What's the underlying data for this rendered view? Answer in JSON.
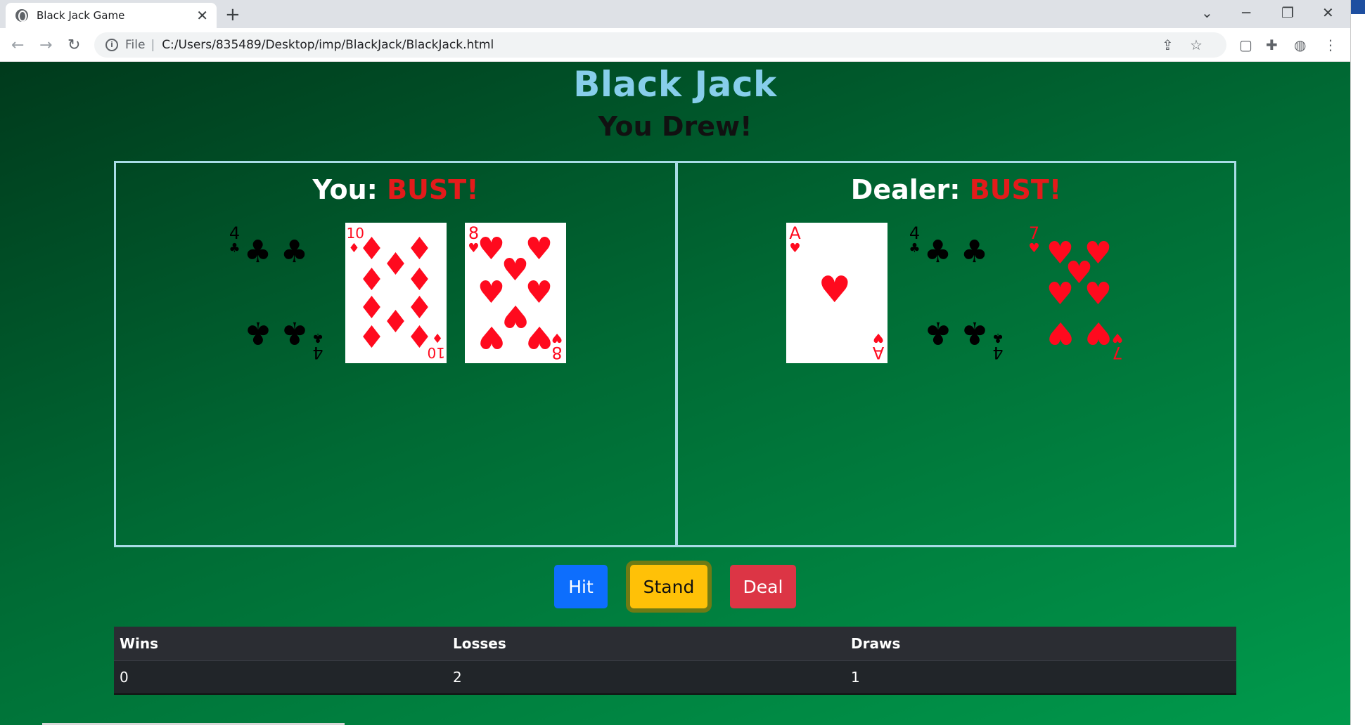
{
  "browser": {
    "tab_title": "Black Jack Game",
    "address_scheme": "File",
    "address_path": "C:/Users/835489/Desktop/imp/BlackJack/BlackJack.html"
  },
  "game": {
    "title": "Black Jack",
    "message": "You Drew!",
    "player": {
      "label": "You:",
      "status": "BUST!",
      "cards": [
        {
          "rank": "4",
          "suit": "clubs"
        },
        {
          "rank": "10",
          "suit": "diamonds"
        },
        {
          "rank": "8",
          "suit": "hearts"
        }
      ]
    },
    "dealer": {
      "label": "Dealer:",
      "status": "BUST!",
      "cards": [
        {
          "rank": "A",
          "suit": "hearts"
        },
        {
          "rank": "4",
          "suit": "clubs"
        },
        {
          "rank": "7",
          "suit": "hearts"
        }
      ]
    }
  },
  "buttons": {
    "hit": "Hit",
    "stand": "Stand",
    "deal": "Deal"
  },
  "score": {
    "headers": {
      "wins": "Wins",
      "losses": "Losses",
      "draws": "Draws"
    },
    "values": {
      "wins": "0",
      "losses": "2",
      "draws": "1"
    }
  },
  "colors": {
    "title": "#87ceeb",
    "bust": "#e31b1b",
    "hit": "#0d6efd",
    "stand": "#ffc107",
    "deal": "#dc3545"
  }
}
